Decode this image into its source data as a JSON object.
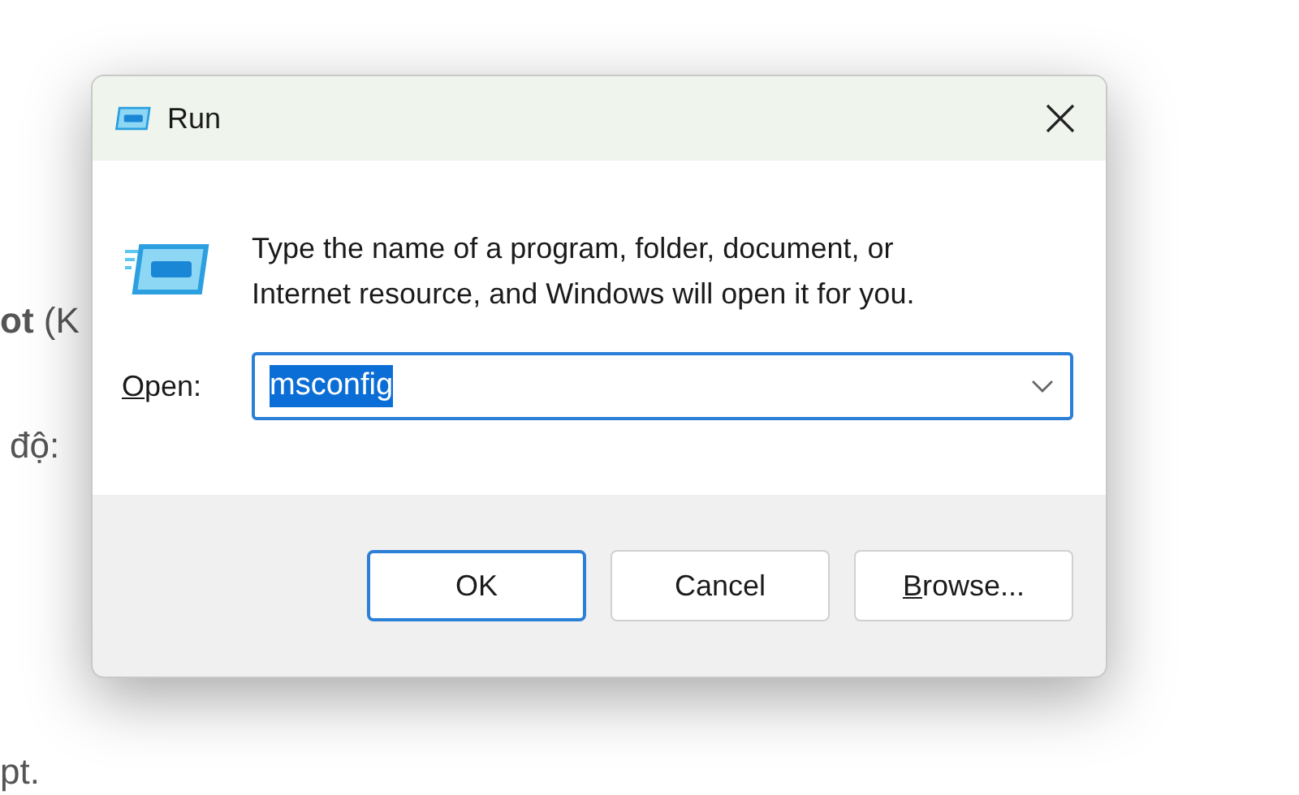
{
  "document": {
    "lines": [
      "**ot** (K",
      "độ:",
      "pt."
    ]
  },
  "dialog": {
    "title": "Run",
    "description": "Type the name of a program, folder, document, or Internet resource, and Windows will open it for you.",
    "open_label": {
      "mnemonic": "O",
      "rest": "pen:"
    },
    "open_value": "msconfig",
    "buttons": [
      {
        "kind": "default",
        "label": "OK"
      },
      {
        "kind": "plain",
        "label": "Cancel"
      },
      {
        "kind": "mnemonic",
        "mnemonic": "B",
        "rest": "rowse..."
      }
    ]
  }
}
